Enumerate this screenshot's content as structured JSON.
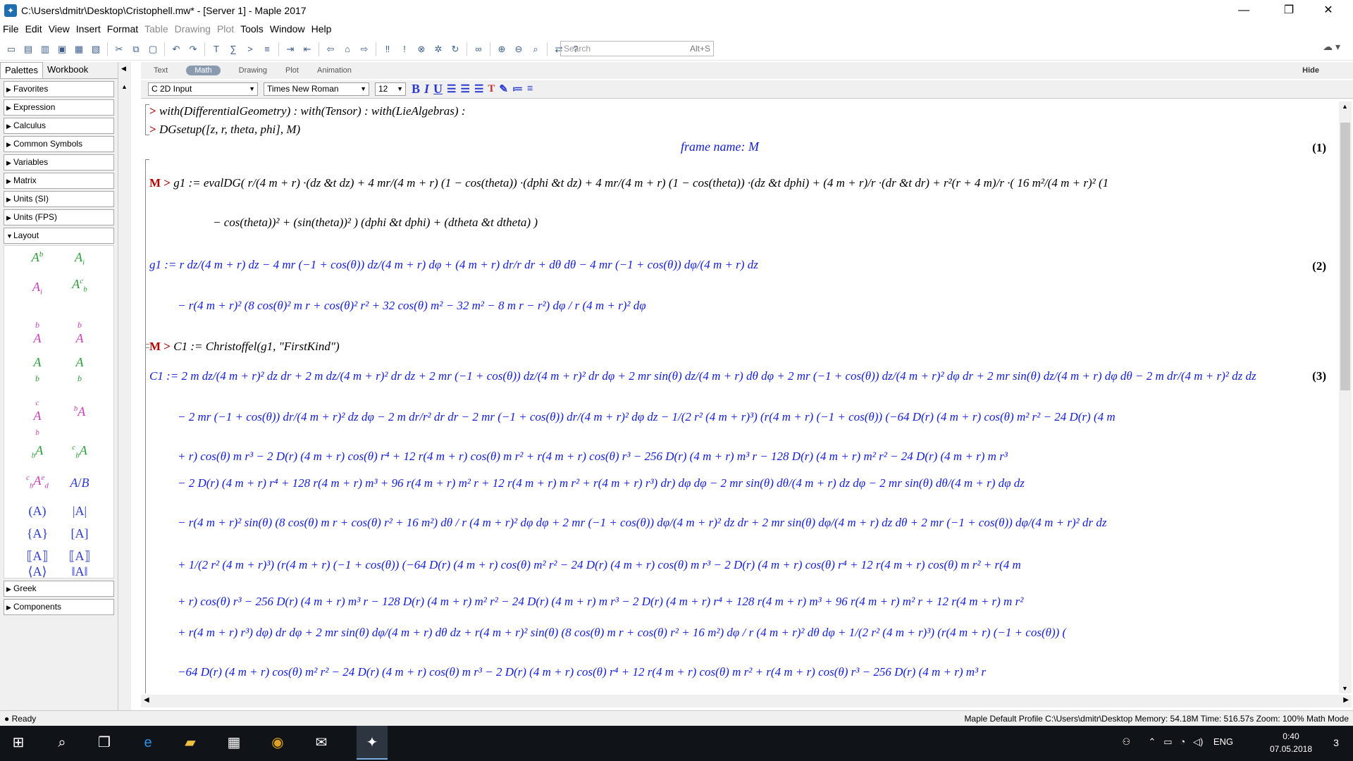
{
  "window": {
    "title": "C:\\Users\\dmitr\\Desktop\\Cristophell.mw* - [Server 1] - Maple 2017",
    "controls": {
      "minimize": "—",
      "maximize": "❐",
      "close": "✕"
    }
  },
  "menu": [
    "File",
    "Edit",
    "View",
    "Insert",
    "Format",
    "Table",
    "Drawing",
    "Plot",
    "Tools",
    "Window",
    "Help"
  ],
  "menu_dimmed": [
    "Table",
    "Drawing",
    "Plot"
  ],
  "search": {
    "placeholder": "Search",
    "shortcut": "Alt+S"
  },
  "palette_tabs": [
    "Palettes",
    "Workbook"
  ],
  "palette_sections": [
    "Favorites",
    "Expression",
    "Calculus",
    "Common Symbols",
    "Variables",
    "Matrix",
    "Units (SI)",
    "Units (FPS)",
    "Layout"
  ],
  "palette_sections_bottom": [
    "Greek",
    "Components"
  ],
  "layout_glyphs": [
    [
      "Aᵇ",
      "Aᵢ"
    ],
    [
      "Aᵢ",
      "A꜀ᵦ"
    ],
    [
      "ᵇA",
      "ᵇA"
    ],
    [
      "ᵃᵦ",
      "ᵃᵦ"
    ],
    [
      "ᶜᵃᵦ",
      "ᵇA"
    ],
    [
      "ᵦA",
      "ᶜᵦA"
    ],
    [
      "ᶜᵦAᵉᵈ",
      "A/B"
    ],
    [
      "(A)",
      "|A|"
    ],
    [
      "{A}",
      "[A]"
    ],
    [
      "⟦A⟧",
      "⟦A⟧"
    ],
    [
      "⟨A⟩",
      "‖A‖"
    ]
  ],
  "doc_tabs": [
    "Text",
    "Math",
    "Drawing",
    "Plot",
    "Animation"
  ],
  "doc_tab_active": "Math",
  "hide_label": "Hide",
  "format_bar": {
    "mode": "C  2D Input",
    "font": "Times New Roman",
    "size": "12"
  },
  "worksheet": {
    "cmd1": "with(DifferentialGeometry) : with(Tensor) : with(LieAlgebras) :",
    "cmd2": "DGsetup([z, r, theta, phi], M)",
    "out_frame": "frame name: M",
    "eq1": "(1)",
    "prompt_m": "M >",
    "cmd3a": "g1 := evalDG( r/(4 m + r) ·(dz &t dz) + 4 mr/(4 m + r) (1 − cos(theta)) ·(dphi &t dz) + 4 mr/(4 m + r) (1 − cos(theta)) ·(dz &t dphi) + (4 m + r)/r ·(dr &t dr) + r²(r + 4 m)/r ·( 16 m²/(4 m + r)² (1",
    "cmd3b": "− cos(theta))² + (sin(theta))² ) (dphi &t dphi) + (dtheta &t dtheta) )",
    "eq2": "(2)",
    "out2a": "g1 := r dz/(4 m + r) dz − 4 mr (−1 + cos(θ)) dz/(4 m + r) dφ + (4 m + r) dr/r dr + dθ dθ − 4 mr (−1 + cos(θ)) dφ/(4 m + r) dz",
    "out2b": "− r(4 m + r)² (8 cos(θ)² m r + cos(θ)² r² + 32 cos(θ) m² − 32 m² − 8 m r − r²) dφ / r (4 m + r)²  dφ",
    "cmd4": "C1 := Christoffel(g1, \"FirstKind\")",
    "eq3": "(3)",
    "out3": [
      "C1 := 2 m dz/(4 m + r)² dz dr + 2 m dz/(4 m + r)² dr dz + 2 mr (−1 + cos(θ)) dz/(4 m + r)² dr dφ + 2 mr sin(θ) dz/(4 m + r) dθ dφ + 2 mr (−1 + cos(θ)) dz/(4 m + r)² dφ dr + 2 mr sin(θ) dz/(4 m + r) dφ dθ − 2 m dr/(4 m + r)² dz dz",
      "− 2 mr (−1 + cos(θ)) dr/(4 m + r)² dz dφ − 2 m dr/r² dr dr − 2 mr (−1 + cos(θ)) dr/(4 m + r)² dφ dz − 1/(2 r² (4 m + r)³) (r(4 m + r) (−1 + cos(θ)) (−64 D(r) (4 m + r) cos(θ) m² r² − 24 D(r) (4 m",
      "+ r) cos(θ) m r³ − 2 D(r) (4 m + r) cos(θ) r⁴ + 12 r(4 m + r) cos(θ) m r² + r(4 m + r) cos(θ) r³ − 256 D(r) (4 m + r) m³ r − 128 D(r) (4 m + r) m² r² − 24 D(r) (4 m + r) m r³",
      "− 2 D(r) (4 m + r) r⁴ + 128 r(4 m + r) m³ + 96 r(4 m + r) m² r + 12 r(4 m + r) m r² + r(4 m + r) r³) dr) dφ dφ − 2 mr sin(θ) dθ/(4 m + r) dz dφ − 2 mr sin(θ) dθ/(4 m + r) dφ dz",
      "− r(4 m + r)² sin(θ) (8 cos(θ) m r + cos(θ) r² + 16 m²) dθ / r (4 m + r)² dφ dφ + 2 mr (−1 + cos(θ)) dφ/(4 m + r)² dz dr + 2 mr sin(θ) dφ/(4 m + r) dz dθ + 2 mr (−1 + cos(θ)) dφ/(4 m + r)² dr dz",
      "+ 1/(2 r² (4 m + r)³) (r(4 m + r) (−1 + cos(θ)) (−64 D(r) (4 m + r) cos(θ) m² r² − 24 D(r) (4 m + r) cos(θ) m r³ − 2 D(r) (4 m + r) cos(θ) r⁴ + 12 r(4 m + r) cos(θ) m r² + r(4 m",
      "+ r) cos(θ) r³ − 256 D(r) (4 m + r) m³ r − 128 D(r) (4 m + r) m² r² − 24 D(r) (4 m + r) m r³ − 2 D(r) (4 m + r) r⁴ + 128 r(4 m + r) m³ + 96 r(4 m + r) m² r + 12 r(4 m + r) m r²",
      "+ r(4 m + r) r³) dφ) dr dφ + 2 mr sin(θ) dφ/(4 m + r) dθ dz + r(4 m + r)² sin(θ) (8 cos(θ) m r + cos(θ) r² + 16 m²) dφ / r (4 m + r)² dθ dφ + 1/(2 r² (4 m + r)³) (r(4 m + r) (−1 + cos(θ)) (",
      "−64 D(r) (4 m + r) cos(θ) m² r² − 24 D(r) (4 m + r) cos(θ) m r³ − 2 D(r) (4 m + r) cos(θ) r⁴ + 12 r(4 m + r) cos(θ) m r² + r(4 m + r) cos(θ) r³ − 256 D(r) (4 m + r) m³ r"
    ]
  },
  "status": {
    "left": "Ready",
    "right": "Maple Default Profile   C:\\Users\\dmitr\\Desktop   Memory: 54.18M   Time: 516.57s   Zoom: 100%   Math Mode"
  },
  "taskbar": {
    "lang": "ENG",
    "time": "0:40",
    "date": "07.05.2018",
    "notif": "3"
  }
}
